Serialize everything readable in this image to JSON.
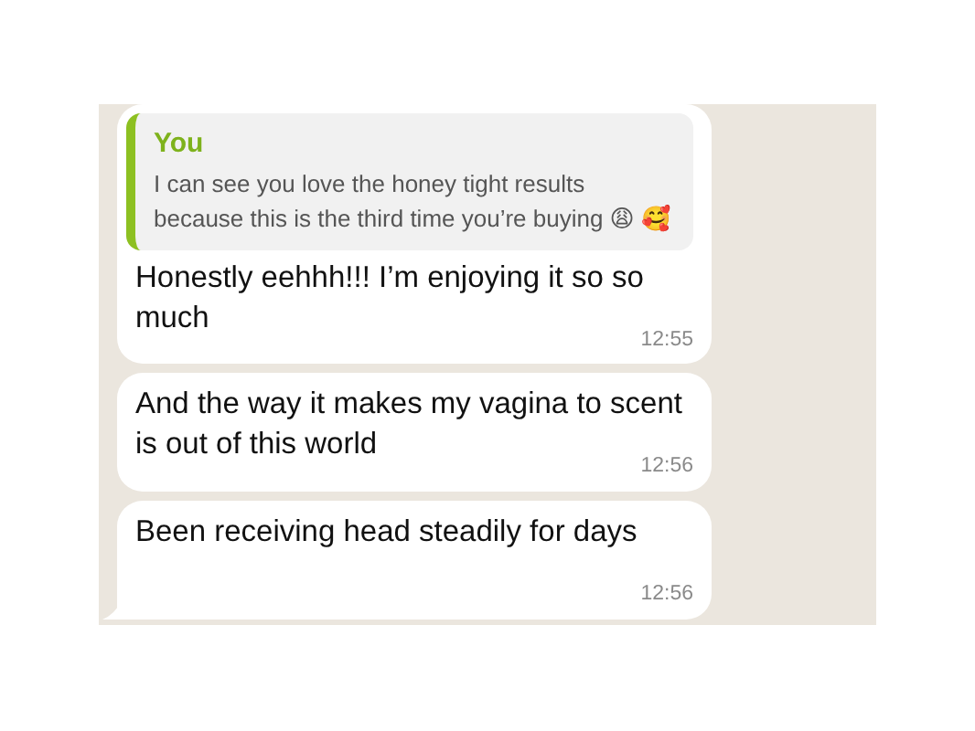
{
  "messages": [
    {
      "quote": {
        "author": "You",
        "text": "I can see you love the honey tight results because this is the third time you’re buying 😩 🥰"
      },
      "text": "Honestly eehhh!!! I’m enjoying it so so much",
      "time": "12:55",
      "tail": false
    },
    {
      "text": "And the way it makes my vagina to scent is out of this world",
      "time": "12:56",
      "tail": false
    },
    {
      "text": "Been receiving head steadily for days",
      "time": "12:56",
      "tail": true
    }
  ]
}
